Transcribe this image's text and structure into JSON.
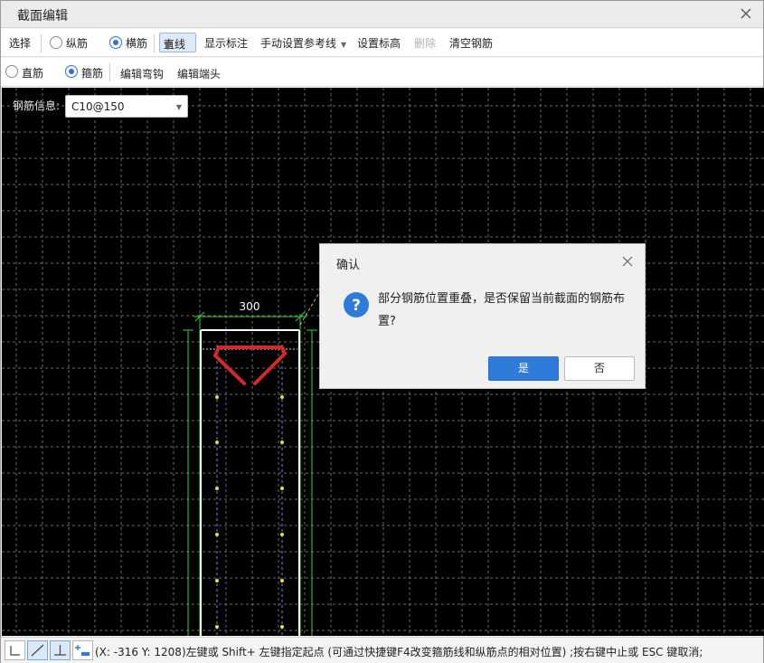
{
  "window": {
    "title": "截面编辑"
  },
  "toolbar1": {
    "select": "选择",
    "longitudinal": "纵筋",
    "transverse": "横筋",
    "line_mode": "直线",
    "show_dims": "显示标注",
    "manual_ref": "手动设置参考线",
    "set_elev": "设置标高",
    "delete": "删除",
    "clear": "清空钢筋"
  },
  "toolbar2": {
    "straight": "直筋",
    "stirrup": "箍筋",
    "edit_hook": "编辑弯钩",
    "edit_end": "编辑端头"
  },
  "canvas": {
    "rebar_info_label": "钢筋信息:",
    "rebar_info_value": "C10@150",
    "dimension": "300",
    "grid_color": "#6a6a6a",
    "section_color": "#ffffff",
    "dim_color": "#33cc33",
    "stirrup_color": "#d22a2a",
    "rebar_point_color": "#e8d84a"
  },
  "dialog": {
    "title": "确认",
    "message": "部分钢筋位置重叠，是否保留当前截面的钢筋布置?",
    "yes": "是",
    "no": "否",
    "accent": "#2f7bd9"
  },
  "status": {
    "text": "(X: -316 Y: 1208)左键或 Shift+ 左键指定起点 (可通过快捷键F4改变箍筋线和纵筋点的相对位置) ;按右键中止或 ESC 键取消;"
  }
}
